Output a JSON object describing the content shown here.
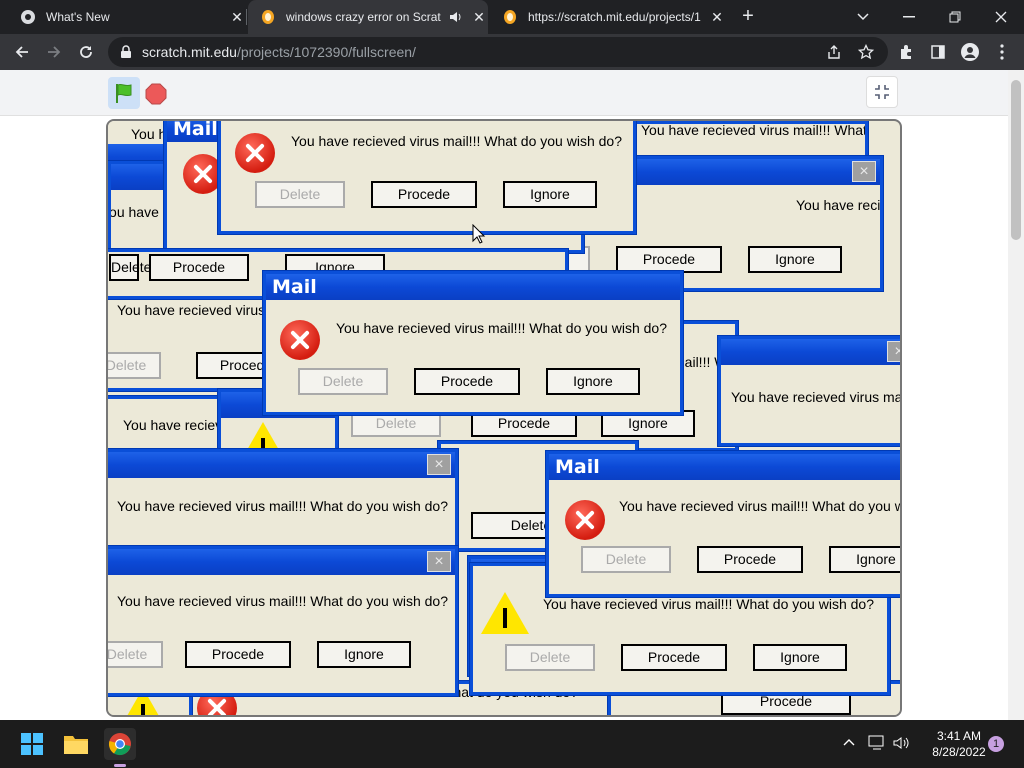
{
  "browser": {
    "tabs": [
      {
        "title": "What's New",
        "active": false
      },
      {
        "title": "windows crazy error on Scrat",
        "active": true
      },
      {
        "title": "https://scratch.mit.edu/projects/1",
        "active": false
      }
    ],
    "url_domain": "scratch.mit.edu",
    "url_path": "/projects/1072390/fullscreen/",
    "new_tab_label": "+"
  },
  "popup_text": {
    "title": "Mail",
    "message": "You have recieved virus mail!!! What do you wish do?",
    "delete": "Delete",
    "procede": "Procede",
    "ignore": "Ignore",
    "close": "×"
  },
  "taskbar": {
    "time": "3:41 AM",
    "date": "8/28/2022",
    "notification_count": "1"
  },
  "colors": {
    "title_bar_blue": "#0a4fd8",
    "popup_body": "#ece9d8",
    "error_red": "#d41d10",
    "warning_yellow": "#ffe600"
  }
}
